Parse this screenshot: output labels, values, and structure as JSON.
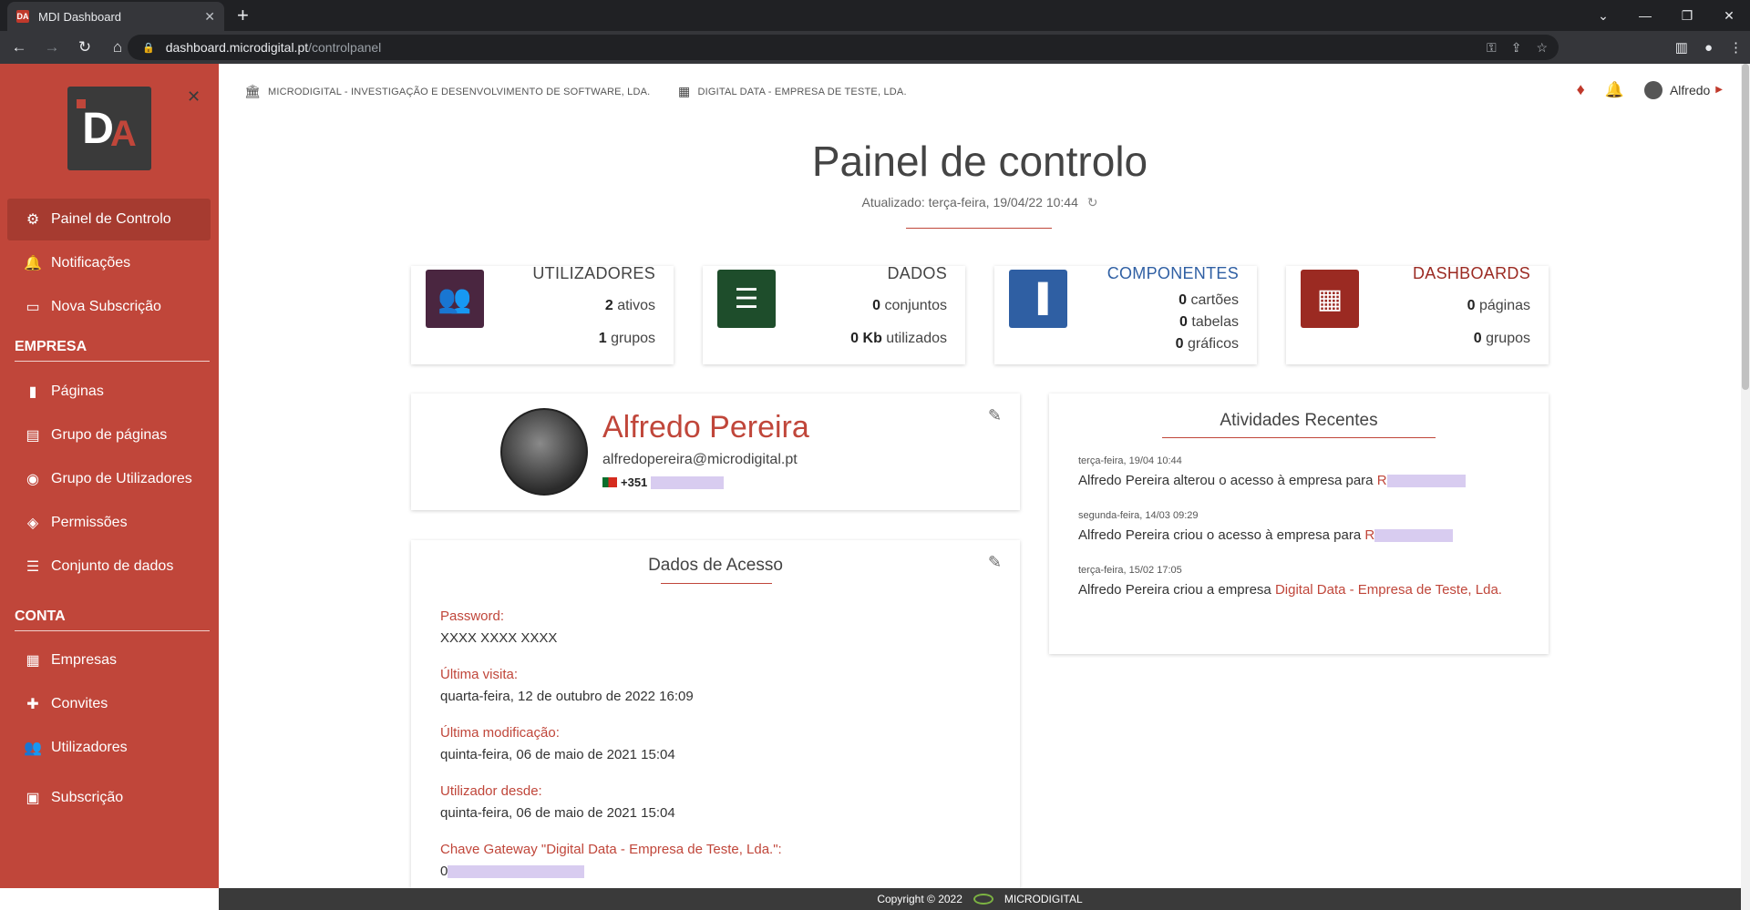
{
  "browser": {
    "tab_title": "MDI Dashboard",
    "favicon_text": "DA",
    "url_host": "dashboard.microdigital.pt",
    "url_path": "/controlpanel"
  },
  "sidebar": {
    "items_top": [
      {
        "label": "Painel de Controlo",
        "icon": "gear-icon",
        "glyph": "⚙",
        "active": true
      },
      {
        "label": "Notificações",
        "icon": "bell-icon",
        "glyph": "🔔"
      },
      {
        "label": "Nova Subscrição",
        "icon": "card-icon",
        "glyph": "▭"
      }
    ],
    "section_company": "EMPRESA",
    "items_company": [
      {
        "label": "Páginas",
        "icon": "book-icon",
        "glyph": "▮"
      },
      {
        "label": "Grupo de páginas",
        "icon": "pages-group-icon",
        "glyph": "▤"
      },
      {
        "label": "Grupo de Utilizadores",
        "icon": "users-group-icon",
        "glyph": "◉"
      },
      {
        "label": "Permissões",
        "icon": "shield-icon",
        "glyph": "◈"
      },
      {
        "label": "Conjunto de dados",
        "icon": "list-icon",
        "glyph": "☰"
      }
    ],
    "section_account": "CONTA",
    "items_account": [
      {
        "label": "Empresas",
        "icon": "building-icon",
        "glyph": "▦"
      },
      {
        "label": "Convites",
        "icon": "person-add-icon",
        "glyph": "✚"
      },
      {
        "label": "Utilizadores",
        "icon": "people-icon",
        "glyph": "👥"
      },
      {
        "label": "Subscrição",
        "icon": "wallet-icon",
        "glyph": "▣"
      }
    ]
  },
  "header": {
    "org1": "MICRODIGITAL - INVESTIGAÇÃO E DESENVOLVIMENTO DE SOFTWARE, LDA.",
    "org2": "DIGITAL DATA - EMPRESA DE TESTE, LDA.",
    "user": "Alfredo"
  },
  "title": "Painel de controlo",
  "updated": "Atualizado: terça-feira, 19/04/22 10:44",
  "stats": [
    {
      "label": "UTILIZADORES",
      "color": "#4a2640",
      "labelColor": "#444",
      "rows": [
        {
          "n": "2",
          "t": "ativos"
        },
        {
          "n": "1",
          "t": "grupos"
        }
      ]
    },
    {
      "label": "DADOS",
      "color": "#1e4d2b",
      "labelColor": "#444",
      "rows": [
        {
          "n": "0",
          "t": "conjuntos"
        },
        {
          "n": "0 Kb",
          "t": "utilizados"
        }
      ]
    },
    {
      "label": "COMPONENTES",
      "color": "#2f5fa3",
      "labelColor": "#2f5fa3",
      "rows": [
        {
          "n": "0",
          "t": "cartões"
        },
        {
          "n": "0",
          "t": "tabelas"
        },
        {
          "n": "0",
          "t": "gráficos"
        }
      ]
    },
    {
      "label": "DASHBOARDS",
      "color": "#9b2a22",
      "labelColor": "#9b2a22",
      "rows": [
        {
          "n": "0",
          "t": "páginas"
        },
        {
          "n": "0",
          "t": "grupos"
        }
      ]
    }
  ],
  "profile": {
    "name": "Alfredo Pereira",
    "email": "alfredopereira@microdigital.pt",
    "phone_prefix": "+351"
  },
  "access": {
    "title": "Dados de Acesso",
    "fields": [
      {
        "label": "Password:",
        "value": "XXXX XXXX XXXX"
      },
      {
        "label": "Última visita:",
        "value": "quarta-feira, 12 de outubro de 2022 16:09"
      },
      {
        "label": "Última modificação:",
        "value": "quinta-feira, 06 de maio de 2021 15:04"
      },
      {
        "label": "Utilizador desde:",
        "value": "quinta-feira, 06 de maio de 2021 15:04"
      },
      {
        "label": "Chave Gateway \"Digital Data - Empresa de Teste, Lda.\":",
        "value": "0"
      }
    ]
  },
  "activities": {
    "title": "Atividades Recentes",
    "items": [
      {
        "date": "terça-feira, 19/04 10:44",
        "text": "Alfredo Pereira alterou o acesso à empresa para ",
        "link": "R"
      },
      {
        "date": "segunda-feira, 14/03 09:29",
        "text": "Alfredo Pereira criou o acesso à empresa para ",
        "link": "R"
      },
      {
        "date": "terça-feira, 15/02 17:05",
        "text": "Alfredo Pereira criou a empresa ",
        "link": "Digital Data - Empresa de Teste, Lda."
      }
    ]
  },
  "footer": {
    "copyright": "Copyright © 2022",
    "brand": "MICRODIGITAL"
  }
}
